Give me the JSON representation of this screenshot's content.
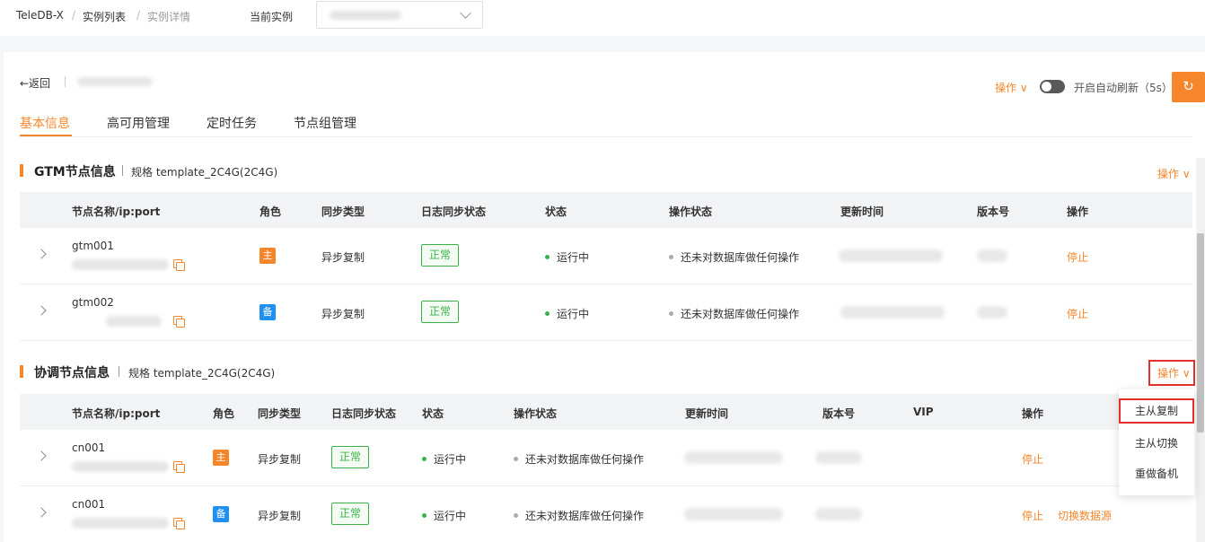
{
  "breadcrumb": {
    "root": "TeleDB-X",
    "sep": "/",
    "list": "实例列表",
    "detail": "实例详情"
  },
  "instance_selector": {
    "label": "当前实例"
  },
  "header": {
    "back": "←返回",
    "operate": "操作 ∨",
    "auto_refresh": "开启自动刷新（5s）",
    "refresh_icon": "↻"
  },
  "tabs": [
    "基本信息",
    "高可用管理",
    "定时任务",
    "节点组管理"
  ],
  "gtm": {
    "title": "GTM节点信息",
    "spec": "规格 template_2C4G(2C4G)",
    "operate": "操作 ∨",
    "columns": [
      "节点名称/ip:port",
      "角色",
      "同步类型",
      "日志同步状态",
      "状态",
      "操作状态",
      "更新时间",
      "版本号",
      "操作"
    ],
    "rows": [
      {
        "name": "gtm001",
        "role": "主",
        "sync_type": "异步复制",
        "log_sync": "正常",
        "status": "运行中",
        "op_status": "还未对数据库做任何操作",
        "action": "停止"
      },
      {
        "name": "gtm002",
        "role": "备",
        "sync_type": "异步复制",
        "log_sync": "正常",
        "status": "运行中",
        "op_status": "还未对数据库做任何操作",
        "action": "停止"
      }
    ]
  },
  "cn": {
    "title": "协调节点信息",
    "spec": "规格 template_2C4G(2C4G)",
    "operate": "操作 ∨",
    "columns": [
      "节点名称/ip:port",
      "角色",
      "同步类型",
      "日志同步状态",
      "状态",
      "操作状态",
      "更新时间",
      "版本号",
      "VIP",
      "操作"
    ],
    "rows": [
      {
        "name": "cn001",
        "role": "主",
        "sync_type": "异步复制",
        "log_sync": "正常",
        "status": "运行中",
        "op_status": "还未对数据库做任何操作",
        "action": "停止"
      },
      {
        "name": "cn001",
        "role": "备",
        "sync_type": "异步复制",
        "log_sync": "正常",
        "status": "运行中",
        "op_status": "还未对数据库做任何操作",
        "action": "停止",
        "action2": "切换数据源"
      }
    ]
  },
  "dropdown": {
    "items": [
      "主从复制",
      "主从切换",
      "重做备机"
    ]
  },
  "colors": {
    "accent": "#f5862b",
    "success": "#3bb34a",
    "standby": "#1f8ff0",
    "highlight": "#e3302f"
  }
}
